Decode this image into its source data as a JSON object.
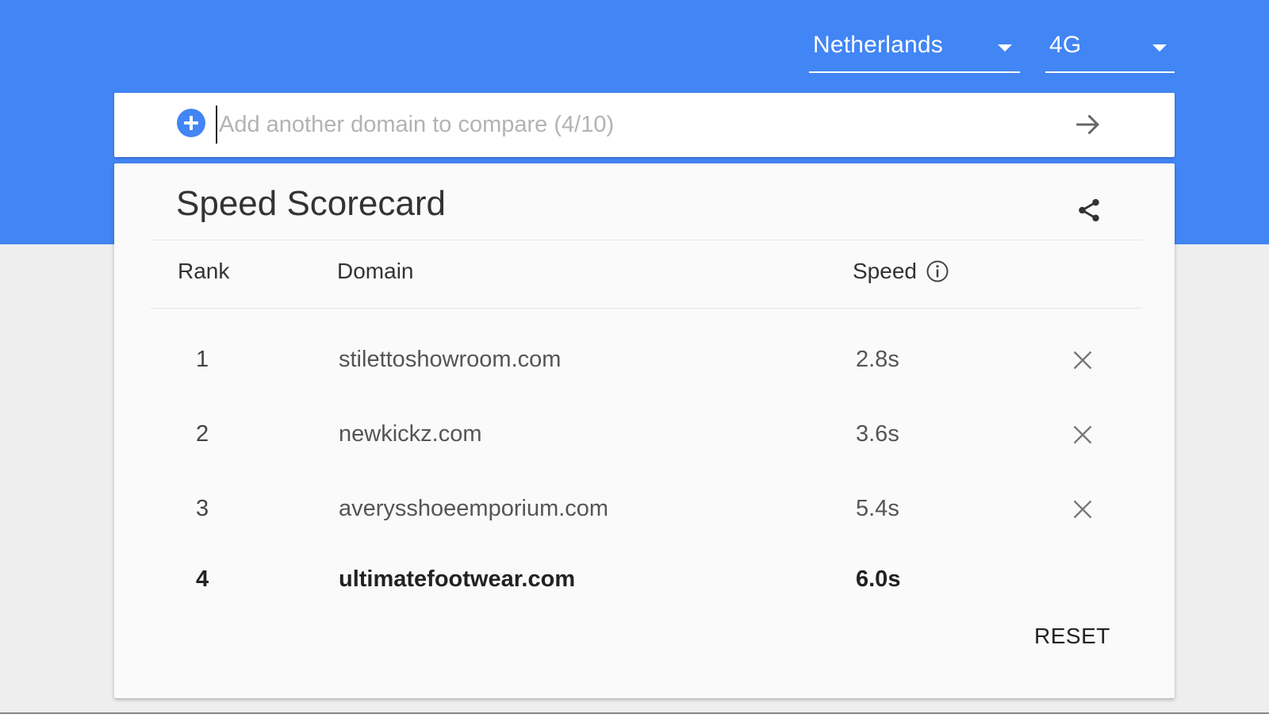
{
  "filters": {
    "country": "Netherlands",
    "network": "4G"
  },
  "search": {
    "placeholder": "Add another domain to compare (4/10)",
    "value": ""
  },
  "scorecard": {
    "title": "Speed Scorecard",
    "columns": {
      "rank": "Rank",
      "domain": "Domain",
      "speed": "Speed"
    },
    "rows": [
      {
        "rank": "1",
        "domain": "stilettoshowroom.com",
        "speed": "2.8s",
        "removable": true
      },
      {
        "rank": "2",
        "domain": "newkickz.com",
        "speed": "3.6s",
        "removable": true
      },
      {
        "rank": "3",
        "domain": "averysshoeemporium.com",
        "speed": "5.4s",
        "removable": true
      },
      {
        "rank": "4",
        "domain": "ultimatefootwear.com",
        "speed": "6.0s",
        "removable": false
      }
    ],
    "reset_label": "RESET"
  },
  "colors": {
    "brand_blue": "#4285f4",
    "page_background": "#eeeeee",
    "card_background": "#fafafa"
  },
  "icons": [
    "plus-icon",
    "arrow-right-icon",
    "share-icon",
    "info-icon",
    "close-icon",
    "chevron-down-icon"
  ]
}
